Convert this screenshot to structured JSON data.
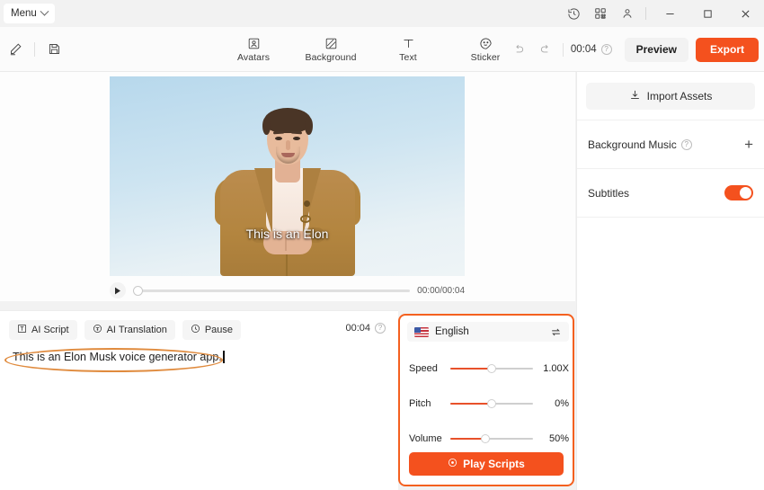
{
  "titlebar": {
    "menu_label": "Menu",
    "icons": [
      "history-icon",
      "grid-icon",
      "account-icon"
    ],
    "window_controls": [
      "minimize",
      "maximize",
      "close"
    ]
  },
  "toolbar": {
    "left_icons": [
      "edit-pencil-icon",
      "save-icon"
    ],
    "items": [
      {
        "label": "Avatars",
        "icon": "avatar-icon"
      },
      {
        "label": "Background",
        "icon": "background-icon"
      },
      {
        "label": "Text",
        "icon": "text-icon"
      },
      {
        "label": "Sticker",
        "icon": "sticker-icon"
      }
    ],
    "undo": "undo-icon",
    "redo": "redo-icon",
    "duration": "00:04",
    "help_glyph": "?",
    "preview_label": "Preview",
    "export_label": "Export"
  },
  "stage": {
    "subtitle_text": "This is an Elon",
    "player": {
      "play_icon": "play-icon",
      "progress_percent": 0,
      "time_label": "00:00/00:04"
    }
  },
  "right_panel": {
    "import_label": "Import Assets",
    "import_icon": "download-icon",
    "background_music": {
      "label": "Background Music",
      "help_glyph": "?",
      "add_glyph": "+"
    },
    "subtitles": {
      "label": "Subtitles",
      "enabled": true
    }
  },
  "script_pane": {
    "chips": [
      {
        "label": "AI Script",
        "icon": "text-box-icon"
      },
      {
        "label": "AI Translation",
        "icon": "translate-icon"
      },
      {
        "label": "Pause",
        "icon": "clock-icon"
      }
    ],
    "duration": "00:04",
    "help_glyph": "?",
    "text": "This is an Elon Musk voice generator app."
  },
  "voice_panel": {
    "language": "English",
    "flag": "us-flag-icon",
    "swap_icon": "swap-icon",
    "sliders": [
      {
        "label": "Speed",
        "value": "1.00X",
        "percent": 50
      },
      {
        "label": "Pitch",
        "value": "0%",
        "percent": 50
      },
      {
        "label": "Volume",
        "value": "50%",
        "percent": 42
      }
    ],
    "play_button": {
      "label": "Play Scripts",
      "icon": "play-circle-icon"
    }
  },
  "colors": {
    "accent": "#f4511e",
    "annotation": "#e08b3e",
    "panel_border": "#f4601f"
  }
}
